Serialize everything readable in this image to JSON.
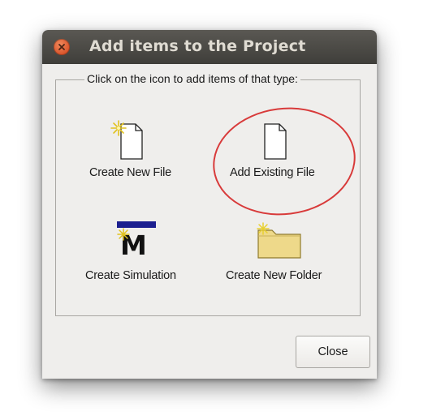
{
  "window": {
    "title": "Add items to the Project"
  },
  "group": {
    "legend": "Click on the icon to add items of that type:"
  },
  "items": [
    {
      "label": "Create New File",
      "icon": "new-file-icon"
    },
    {
      "label": "Add Existing File",
      "icon": "existing-file-icon"
    },
    {
      "label": "Create Simulation",
      "icon": "simulation-icon"
    },
    {
      "label": "Create New Folder",
      "icon": "new-folder-icon"
    }
  ],
  "buttons": {
    "close_label": "Close"
  },
  "colors": {
    "titlebar": "#4a4945",
    "title_text": "#dfdbd2",
    "close_circle": "#e2612f",
    "dialog_bg": "#efeeec",
    "highlight": "#d83a3a",
    "folder": "#eed98a",
    "simulation_bar": "#1c1f8f"
  }
}
